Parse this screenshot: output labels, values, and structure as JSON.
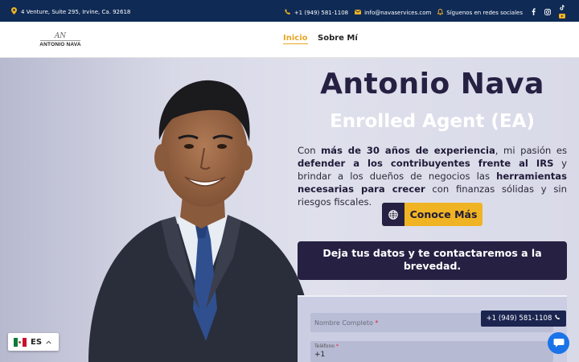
{
  "topbar": {
    "address": "4 Venture, Suite 295, Irvine, Ca. 92618",
    "phone": "+1 (949) 581-1108",
    "email": "info@navaservices.com",
    "social_label": "Síguenos en redes sociales",
    "icons": [
      "map-pin-icon",
      "phone-icon",
      "mail-icon",
      "bell-icon",
      "facebook-icon",
      "instagram-icon",
      "tiktok-icon",
      "youtube-icon"
    ]
  },
  "logo": {
    "signature": "AN",
    "name": "ANTONIO NAVA"
  },
  "nav": {
    "items": [
      {
        "label": "Inicio",
        "active": true
      },
      {
        "label": "Sobre Mí",
        "active": false
      }
    ]
  },
  "hero": {
    "title": "Antonio Nava",
    "subtitle": "Enrolled Agent (EA)",
    "para": {
      "p1": "Con ",
      "b1": "más de 30 años de experiencia",
      "p2": ", mi pasión es ",
      "b2": "defender a los contribuyentes frente al IRS",
      "p3": " y brindar a los dueños de negocios las ",
      "b3": "herramientas necesarias para crecer",
      "p4": " con finanzas sólidas y sin riesgos fiscales."
    },
    "cta_label": "Conoce Más",
    "banner": "Deja tus datos y te contactaremos a la brevedad."
  },
  "form": {
    "name_placeholder": "Nombre Completo",
    "required_mark": "*",
    "phone_label": "Teléfono",
    "phone_value": "+1"
  },
  "floating": {
    "phone": "+1 (949) 581-1108",
    "language": "ES"
  },
  "colors": {
    "topbar": "#0f2a55",
    "accent": "#f0b323",
    "navy": "#262043",
    "chat": "#1a73e8"
  }
}
